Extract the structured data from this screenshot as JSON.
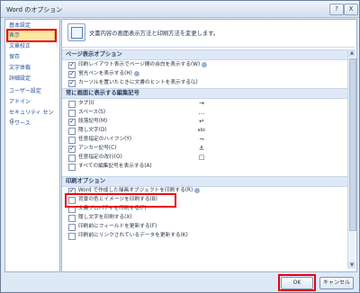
{
  "window": {
    "title": "Word のオプション",
    "help_button": "?",
    "close_button": "X"
  },
  "sidebar": {
    "items": [
      {
        "label": "基本設定",
        "selected": false
      },
      {
        "label": "表示",
        "selected": true
      },
      {
        "label": "文章校正",
        "selected": false
      },
      {
        "label": "保存",
        "selected": false
      },
      {
        "label": "文字体裁",
        "selected": false
      },
      {
        "label": "詳細設定",
        "selected": false
      },
      {
        "label": "ユーザー設定",
        "selected": false
      },
      {
        "label": "アドイン",
        "selected": false
      },
      {
        "label": "セキュリティ センター",
        "selected": false
      },
      {
        "label": "リソース",
        "selected": false
      }
    ]
  },
  "content": {
    "header_text": "文書内容の画面表示方法と印刷方法を変更します。",
    "sections": [
      {
        "title": "ページ表示オプション",
        "items": [
          {
            "label": "印刷レイアウト表示でページ間の余白を表示する(W)",
            "checked": true,
            "info": "ⓘ"
          },
          {
            "label": "蛍光ペンを表示する(H)",
            "checked": true,
            "info": "ⓘ"
          },
          {
            "label": "カーソルを置いたときに文書のヒントを表示する(L)",
            "checked": true,
            "info": ""
          }
        ]
      },
      {
        "title": "常に画面に表示する編集記号",
        "items": [
          {
            "label": "タブ(I)",
            "checked": false,
            "symbol": "→"
          },
          {
            "label": "スペース(S)",
            "checked": false,
            "symbol": "…"
          },
          {
            "label": "段落記号(M)",
            "checked": true,
            "symbol": "↵"
          },
          {
            "label": "隠し文字(D)",
            "checked": false,
            "symbol": "abc"
          },
          {
            "label": "任意指定のハイフン(Y)",
            "checked": false,
            "symbol": "¬"
          },
          {
            "label": "アンカー記号(C)",
            "checked": true,
            "symbol": "⚓"
          },
          {
            "label": "任意指定の改行(O)",
            "checked": false,
            "symbol": "□"
          },
          {
            "label": "すべての編集記号を表示する(A)",
            "checked": false,
            "symbol": ""
          }
        ]
      },
      {
        "title": "印刷オプション",
        "items": [
          {
            "label": "Word で作成した描画オブジェクトを印刷する(R)",
            "checked": true,
            "info": "ⓘ"
          },
          {
            "label": "背景の色とイメージを印刷する(B)",
            "checked": false,
            "info": ""
          },
          {
            "label": "文書プロパティを印刷する(P)",
            "checked": false,
            "info": ""
          },
          {
            "label": "隠し文字を印刷する(X)",
            "checked": false,
            "info": ""
          },
          {
            "label": "印刷前にフィールドを更新する(F)",
            "checked": false,
            "info": ""
          },
          {
            "label": "印刷前にリンクされているデータを更新する(K)",
            "checked": false,
            "info": ""
          }
        ]
      }
    ]
  },
  "footer": {
    "ok_label": "OK",
    "cancel_label": "キャンセル"
  },
  "colors": {
    "highlight_red": "#e60012",
    "section_bg": "#dfe8f6",
    "selection_bg": "#fde7a1"
  }
}
